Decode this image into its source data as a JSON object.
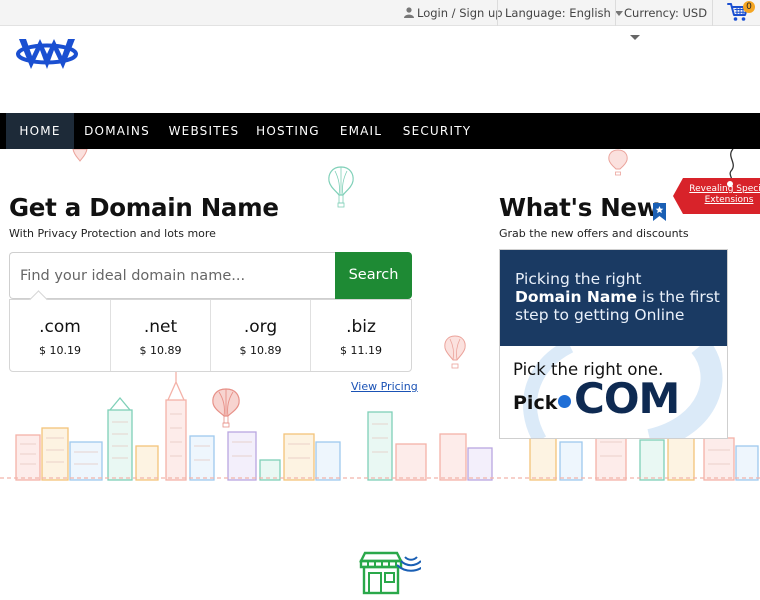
{
  "topbar": {
    "login": "Login / Sign up",
    "language_label": "Language:",
    "language_value": "English",
    "currency_label": "Currency:",
    "currency_value": "USD",
    "cart_count": "0"
  },
  "nav": {
    "items": [
      "HOME",
      "DOMAINS",
      "WEBSITES",
      "HOSTING",
      "EMAIL",
      "SECURITY"
    ],
    "active": "HOME"
  },
  "domain_search": {
    "title": "Get a Domain Name",
    "subtitle": "With Privacy Protection and lots more",
    "placeholder": "Find your ideal domain name...",
    "button": "Search",
    "tlds": [
      {
        "name": ".com",
        "price": "$ 10.19"
      },
      {
        "name": ".net",
        "price": "$ 10.89"
      },
      {
        "name": ".org",
        "price": "$ 10.89"
      },
      {
        "name": ".biz",
        "price": "$ 11.19"
      }
    ],
    "view_pricing": "View Pricing"
  },
  "whats_new": {
    "title": "What's New",
    "subtitle": "Grab the new offers and discounts",
    "promo_line1": "Picking the right",
    "promo_line2_bold": "Domain Name",
    "promo_line2_rest": " is the first",
    "promo_line3": "step to getting Online",
    "promo_pick": "Pick the right one.",
    "promo_logo_pick": "Pick",
    "promo_logo_com": "COM"
  },
  "ribbon": {
    "line1": "Revealing Special",
    "line2": "Extensions"
  },
  "colors": {
    "nav_bg": "#000000",
    "nav_active": "#1d2a38",
    "search_button": "#1e8a34",
    "brand_blue": "#1a4fd1",
    "promo_navy": "#1a3a63",
    "ribbon_red": "#d8232a",
    "link_blue": "#1a52b5"
  },
  "icons": [
    "user-icon",
    "cart-icon",
    "bookmark-icon",
    "store-icon",
    "logo-w-icon"
  ]
}
